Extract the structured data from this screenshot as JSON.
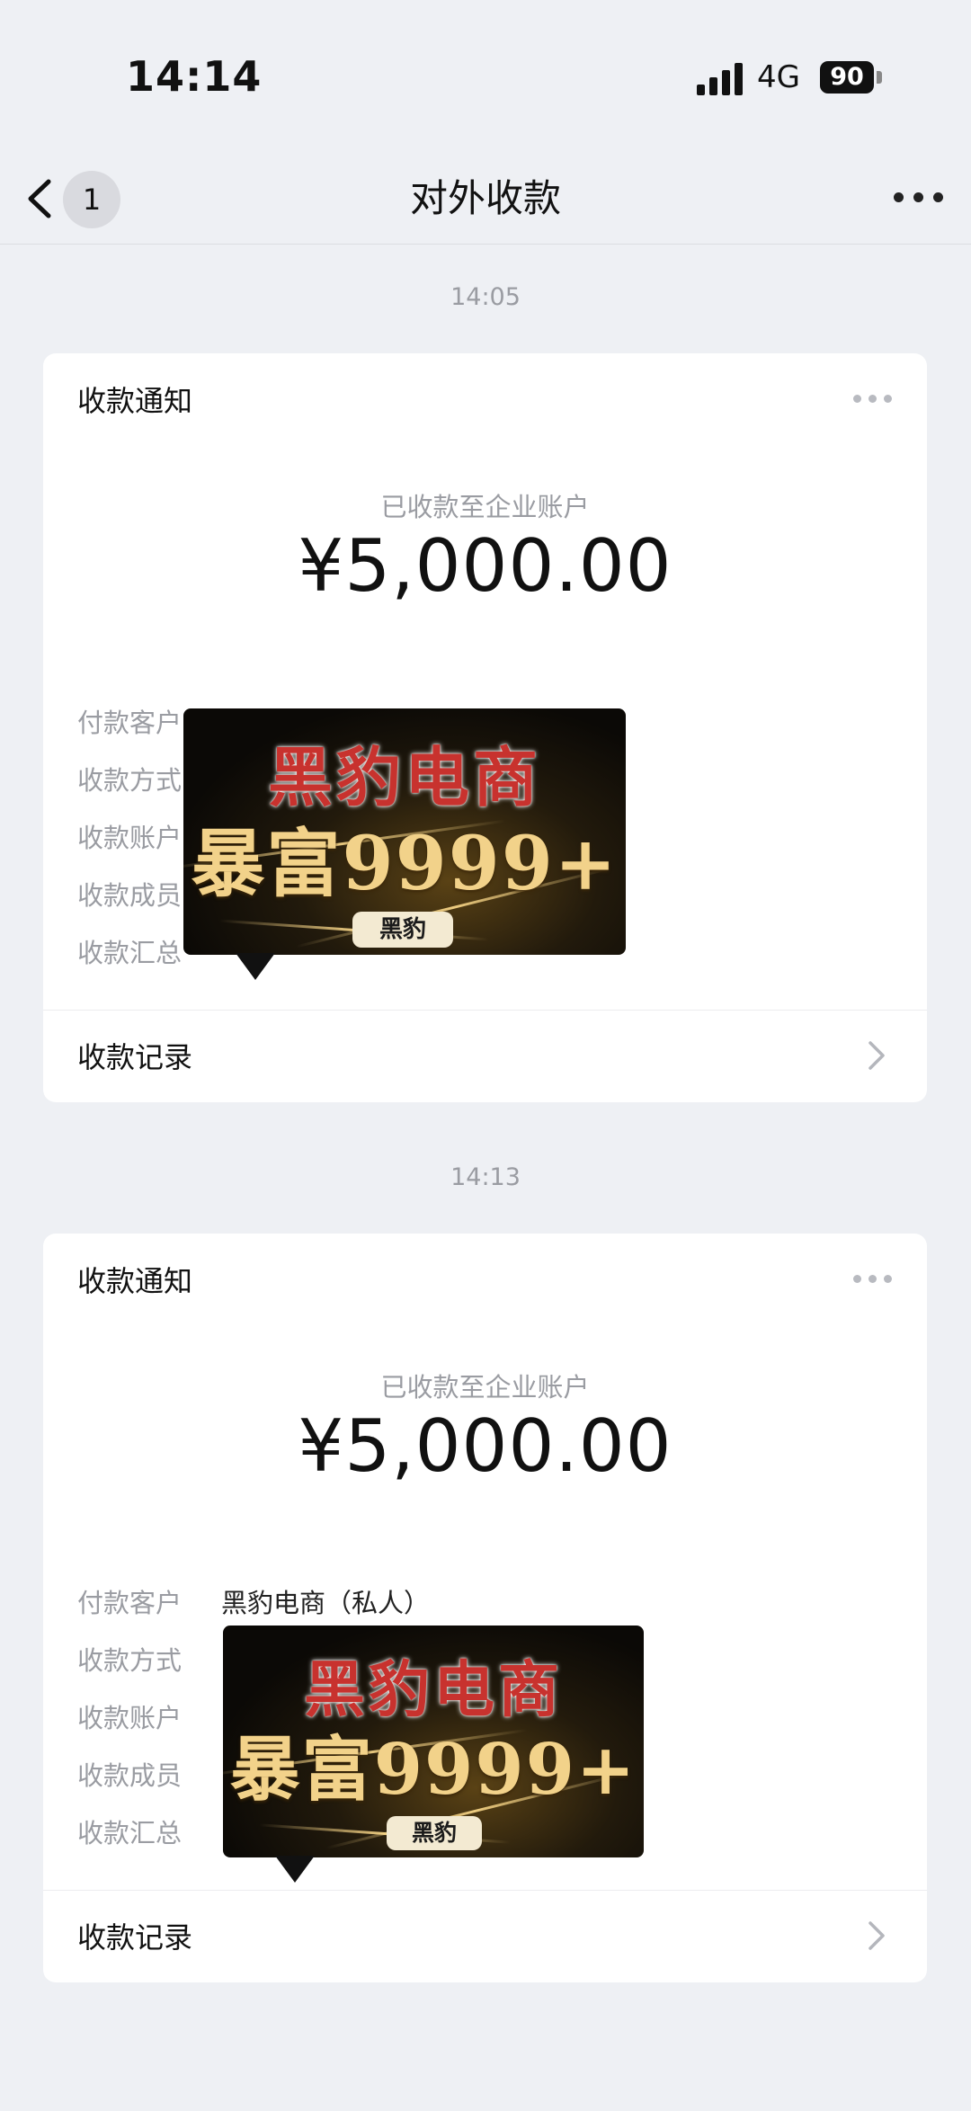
{
  "status_bar": {
    "time": "14:14",
    "network": "4G",
    "battery": "90"
  },
  "nav": {
    "badge": "1",
    "title": "对外收款"
  },
  "messages": [
    {
      "timestamp": "14:05",
      "card_title": "收款通知",
      "subtitle": "已收款至企业账户",
      "amount": "¥5,000.00",
      "rows": [
        {
          "label": "付款客户",
          "value": ""
        },
        {
          "label": "收款方式",
          "value": ""
        },
        {
          "label": "收款账户",
          "value": ""
        },
        {
          "label": "收款成员",
          "value": ""
        },
        {
          "label": "收款汇总",
          "value": ""
        }
      ],
      "footer": "收款记录"
    },
    {
      "timestamp": "14:13",
      "card_title": "收款通知",
      "subtitle": "已收款至企业账户",
      "amount": "¥5,000.00",
      "rows": [
        {
          "label": "付款客户",
          "value": "黑豹电商（私人）"
        },
        {
          "label": "收款方式",
          "value": ""
        },
        {
          "label": "收款账户",
          "value": ""
        },
        {
          "label": "收款成员",
          "value": ""
        },
        {
          "label": "收款汇总",
          "value": ""
        }
      ],
      "footer": "收款记录"
    }
  ],
  "ad_sticker": {
    "line1": "黑豹电商",
    "line2": "暴富9999+",
    "tag": "黑豹"
  },
  "colors": {
    "background": "#eef0f4",
    "card": "#ffffff",
    "muted_text": "#9a9ca2",
    "ad_red": "#c8322e",
    "ad_gold": "#f2d28a"
  }
}
